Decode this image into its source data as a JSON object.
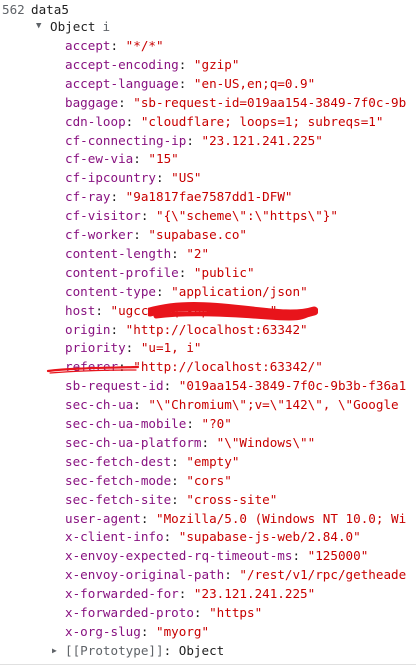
{
  "line_number": "562",
  "variable": "data5",
  "object_label": "Object",
  "info_glyph": "i",
  "expand_arrow": "▼",
  "collapsed_arrow": "▶",
  "props": [
    {
      "key": "accept",
      "value": "\"*/*\""
    },
    {
      "key": "accept-encoding",
      "value": "\"gzip\""
    },
    {
      "key": "accept-language",
      "value": "\"en-US,en;q=0.9\""
    },
    {
      "key": "baggage",
      "value": "\"sb-request-id=019aa154-3849-7f0c-9b"
    },
    {
      "key": "cdn-loop",
      "value": "\"cloudflare; loops=1; subreqs=1\""
    },
    {
      "key": "cf-connecting-ip",
      "value": "\"23.121.241.225\""
    },
    {
      "key": "cf-ew-via",
      "value": "\"15\""
    },
    {
      "key": "cf-ipcountry",
      "value": "\"US\""
    },
    {
      "key": "cf-ray",
      "value": "\"9a1817fae7587dd1-DFW\""
    },
    {
      "key": "cf-visitor",
      "value": "\"{\\\"scheme\\\":\\\"https\\\"}\""
    },
    {
      "key": "cf-worker",
      "value": "\"supabase.co\""
    },
    {
      "key": "content-length",
      "value": "\"2\""
    },
    {
      "key": "content-profile",
      "value": "\"public\""
    },
    {
      "key": "content-type",
      "value": "\"application/json\""
    },
    {
      "key": "host",
      "value": "\"ugcc                 pbq.supabase.co\""
    },
    {
      "key": "origin",
      "value": "\"http://localhost:63342\""
    },
    {
      "key": "priority",
      "value": "\"u=1, i\""
    },
    {
      "key": "referer",
      "value": "\"http://localhost:63342/\""
    },
    {
      "key": "sb-request-id",
      "value": "\"019aa154-3849-7f0c-9b3b-f36a1"
    },
    {
      "key": "sec-ch-ua",
      "value": "\"\\\"Chromium\\\";v=\\\"142\\\", \\\"Google"
    },
    {
      "key": "sec-ch-ua-mobile",
      "value": "\"?0\""
    },
    {
      "key": "sec-ch-ua-platform",
      "value": "\"\\\"Windows\\\"\""
    },
    {
      "key": "sec-fetch-dest",
      "value": "\"empty\""
    },
    {
      "key": "sec-fetch-mode",
      "value": "\"cors\""
    },
    {
      "key": "sec-fetch-site",
      "value": "\"cross-site\""
    },
    {
      "key": "user-agent",
      "value": "\"Mozilla/5.0 (Windows NT 10.0; Wi"
    },
    {
      "key": "x-client-info",
      "value": "\"supabase-js-web/2.84.0\""
    },
    {
      "key": "x-envoy-expected-rq-timeout-ms",
      "value": "\"125000\""
    },
    {
      "key": "x-envoy-original-path",
      "value": "\"/rest/v1/rpc/getheade"
    },
    {
      "key": "x-forwarded-for",
      "value": "\"23.121.241.225\""
    },
    {
      "key": "x-forwarded-proto",
      "value": "\"https\""
    },
    {
      "key": "x-org-slug",
      "value": "\"myorg\""
    }
  ],
  "prototype": {
    "label": "[[Prototype]]",
    "value": "Object"
  },
  "colors": {
    "key": "#881280",
    "string_value": "#c80000",
    "redaction": "#e8141b"
  }
}
